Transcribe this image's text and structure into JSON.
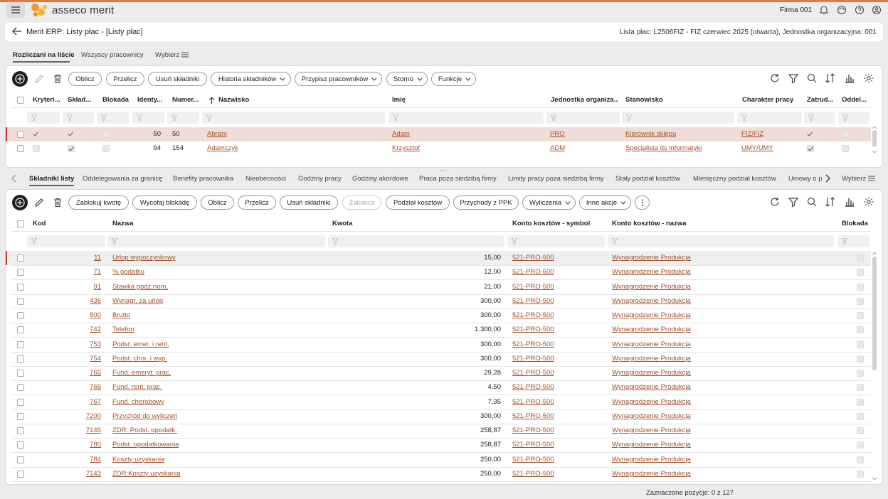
{
  "app": {
    "logo_text": "asseco merit",
    "company": "Firma 001",
    "accent": "#e07b39"
  },
  "title": {
    "text": "Merit ERP: Listy płac - [Listy płac]",
    "right": "Lista płac: L2506FIZ - FIZ czerwiec 2025 (otwarta), Jednostka organizacyjna: 001"
  },
  "top_tabs": [
    "Rozliczani na liście",
    "Wszyscy pracownicy",
    "Wybierz"
  ],
  "upper": {
    "buttons": [
      "Oblicz",
      "Przelicz",
      "Usuń składniki",
      "Historia składników",
      "Przypisz pracowników",
      "Storno",
      "Funkcje"
    ],
    "headers": [
      "Kryteri...",
      "Skład...",
      "Blokada",
      "Identy...",
      "Numer...",
      "Nazwisko",
      "Imię",
      "Jednostka organiza...",
      "Stanowisko",
      "Charakter pracy",
      "Zatrud...",
      "Oddel..."
    ],
    "rows": [
      {
        "id": "50",
        "numer": "50",
        "nazwisko": "Abram",
        "imie": "Adam",
        "jednostka": "PRO",
        "stanowisko": "Kierownik sklepu",
        "charakter": "FIZ/FIZ"
      },
      {
        "id": "94",
        "numer": "154",
        "nazwisko": "Adamczyk",
        "imie": "Krzysztof",
        "jednostka": "ADM",
        "stanowisko": "Specjalista ds informatyki",
        "charakter": "UMY/UMY"
      }
    ]
  },
  "bottom_tabs": [
    "Składniki listy",
    "Oddelegowania za granicę",
    "Benefity pracownika",
    "Nieobecności",
    "Godziny pracy",
    "Godziny akordowe",
    "Praca poza siedzibą firmy",
    "Limity pracy poza siedzibą firmy",
    "Stały podział kosztów",
    "Miesięczny podział kosztów",
    "Umowy o p",
    "Wybierz"
  ],
  "lower": {
    "buttons": [
      "Zablokuj kwotę",
      "Wycofaj blokadę",
      "Oblicz",
      "Przelicz",
      "Usuń składniki",
      "Zakończ",
      "Podział kosztów",
      "Przychody z PPK",
      "Wyliczenia",
      "Inne akcje"
    ],
    "headers": [
      "Kod",
      "Nazwa",
      "Kwota",
      "Konto kosztów - symbol",
      "Konto kosztów - nazwa",
      "Blokada"
    ],
    "rows": [
      {
        "kod": "11",
        "nazwa": "Urlop wypoczynkowy",
        "kwota": "15,00",
        "symbol": "521-PRO-500",
        "konto": "Wynagrodzenie Produkcja"
      },
      {
        "kod": "71",
        "nazwa": "% podatku",
        "kwota": "12,00",
        "symbol": "521-PRO-500",
        "konto": "Wynagrodzenie Produkcja"
      },
      {
        "kod": "91",
        "nazwa": "Stawka godz.nom.",
        "kwota": "21,00",
        "symbol": "521-PRO-500",
        "konto": "Wynagrodzenie Produkcja"
      },
      {
        "kod": "436",
        "nazwa": "Wynagr. za urlop",
        "kwota": "300,00",
        "symbol": "521-PRO-500",
        "konto": "Wynagrodzenie Produkcja"
      },
      {
        "kod": "500",
        "nazwa": "Brutto",
        "kwota": "300,00",
        "symbol": "521-PRO-500",
        "konto": "Wynagrodzenie Produkcja"
      },
      {
        "kod": "742",
        "nazwa": "Telefon",
        "kwota": "1.300,00",
        "symbol": "521-PRO-500",
        "konto": "Wynagrodzenie Produkcja"
      },
      {
        "kod": "753",
        "nazwa": "Podst. emer. i rent.",
        "kwota": "300,00",
        "symbol": "521-PRO-500",
        "konto": "Wynagrodzenie Produkcja"
      },
      {
        "kod": "754",
        "nazwa": "Podst. chor. i wyp.",
        "kwota": "300,00",
        "symbol": "521-PRO-500",
        "konto": "Wynagrodzenie Produkcja"
      },
      {
        "kod": "765",
        "nazwa": "Fund. emeryt. prac.",
        "kwota": "29,28",
        "symbol": "521-PRO-500",
        "konto": "Wynagrodzenie Produkcja"
      },
      {
        "kod": "766",
        "nazwa": "Fund. rent. prac.",
        "kwota": "4,50",
        "symbol": "521-PRO-500",
        "konto": "Wynagrodzenie Produkcja"
      },
      {
        "kod": "767",
        "nazwa": "Fund. chorobowy",
        "kwota": "7,35",
        "symbol": "521-PRO-500",
        "konto": "Wynagrodzenie Produkcja"
      },
      {
        "kod": "7200",
        "nazwa": "Przychód do wyliczeń",
        "kwota": "300,00",
        "symbol": "521-PRO-500",
        "konto": "Wynagrodzenie Produkcja"
      },
      {
        "kod": "7145",
        "nazwa": "ZDR: Podst. opodatk.",
        "kwota": "258,87",
        "symbol": "521-PRO-500",
        "konto": "Wynagrodzenie Produkcja"
      },
      {
        "kod": "780",
        "nazwa": "Podst. opodatkowania",
        "kwota": "258,87",
        "symbol": "521-PRO-500",
        "konto": "Wynagrodzenie Produkcja"
      },
      {
        "kod": "784",
        "nazwa": "Koszty uzyskania",
        "kwota": "250,00",
        "symbol": "521-PRO-500",
        "konto": "Wynagrodzenie Produkcja"
      },
      {
        "kod": "7143",
        "nazwa": "ZDR:Koszty uzyskania",
        "kwota": "250,00",
        "symbol": "521-PRO-500",
        "konto": "Wynagrodzenie Produkcja"
      }
    ]
  },
  "footer": "Zaznaczone pozycje: 0 z 127"
}
